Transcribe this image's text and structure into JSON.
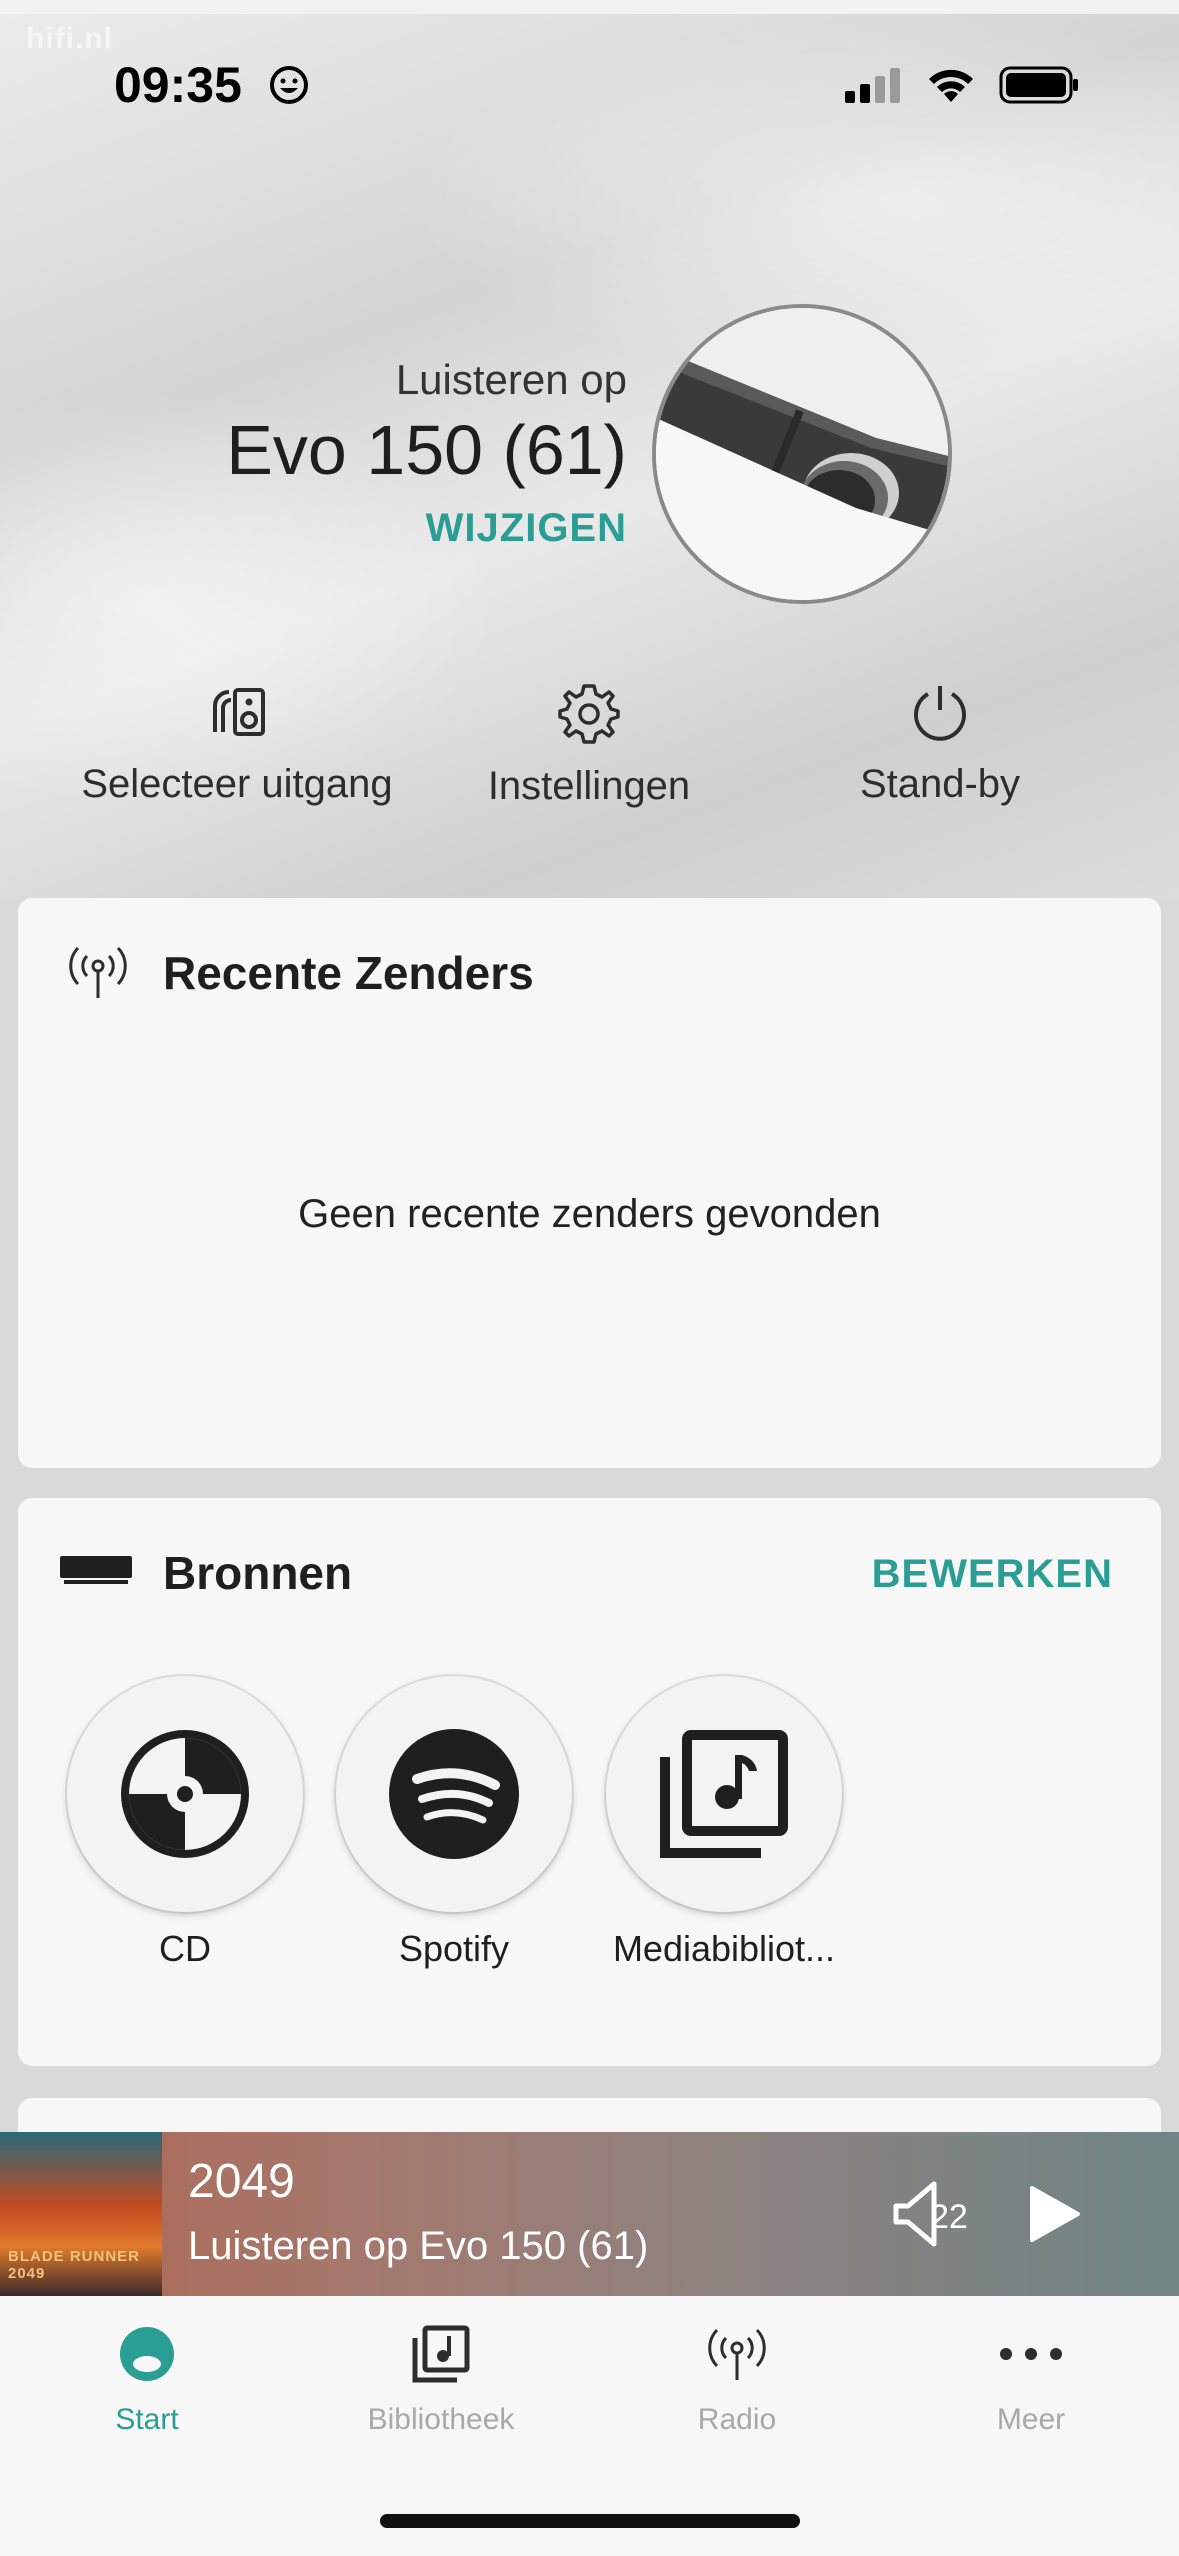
{
  "status_bar": {
    "watermark": "hifi.nl",
    "time": "09:35",
    "icons": [
      "smiley-icon",
      "cellular-icon",
      "wifi-icon",
      "battery-icon"
    ]
  },
  "device": {
    "listen_label": "Luisteren op",
    "name": "Evo 150 (61)",
    "change_label": "WIJZIGEN"
  },
  "quick_actions": [
    {
      "label": "Selecteer uitgang",
      "icon": "speaker-output-icon"
    },
    {
      "label": "Instellingen",
      "icon": "gear-icon"
    },
    {
      "label": "Stand-by",
      "icon": "power-icon"
    }
  ],
  "recent": {
    "title": "Recente Zenders",
    "empty_text": "Geen recente zenders gevonden",
    "icon": "radio-antenna-icon"
  },
  "sources": {
    "title": "Bronnen",
    "edit_label": "BEWERKEN",
    "icon": "device-icon",
    "items": [
      {
        "label": "CD",
        "icon": "cd-icon"
      },
      {
        "label": "Spotify",
        "icon": "spotify-icon"
      },
      {
        "label": "Mediabibliot...",
        "icon": "media-library-icon"
      }
    ]
  },
  "now_playing": {
    "title": "2049",
    "subtitle": "Luisteren op Evo 150 (61)",
    "volume": "22",
    "art_text": "BLADE RUNNER 2049"
  },
  "tabs": [
    {
      "label": "Start",
      "icon": "home-dot-icon",
      "active": true
    },
    {
      "label": "Bibliotheek",
      "icon": "library-icon",
      "active": false
    },
    {
      "label": "Radio",
      "icon": "radio-icon",
      "active": false
    },
    {
      "label": "Meer",
      "icon": "more-icon",
      "active": false
    }
  ],
  "colors": {
    "accent": "#2a9d94",
    "card": "#f7f7f7"
  }
}
